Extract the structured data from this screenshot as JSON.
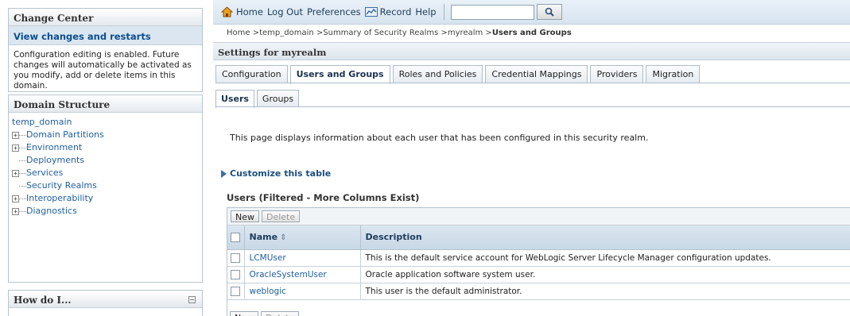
{
  "change_center": {
    "title": "Change Center",
    "link": "View changes and restarts",
    "message": "Configuration editing is enabled. Future changes will automatically be activated as you modify, add or delete items in this domain."
  },
  "domain_structure": {
    "title": "Domain Structure",
    "root": "temp_domain",
    "items": [
      {
        "label": "Domain Partitions",
        "expandable": true
      },
      {
        "label": "Environment",
        "expandable": true
      },
      {
        "label": "Deployments",
        "expandable": false
      },
      {
        "label": "Services",
        "expandable": true
      },
      {
        "label": "Security Realms",
        "expandable": false
      },
      {
        "label": "Interoperability",
        "expandable": true
      },
      {
        "label": "Diagnostics",
        "expandable": true
      }
    ]
  },
  "how_do_i": {
    "title": "How do I..."
  },
  "topbar": {
    "home": "Home",
    "logout": "Log Out",
    "preferences": "Preferences",
    "record": "Record",
    "help": "Help",
    "search_value": ""
  },
  "breadcrumb": {
    "path": "Home >temp_domain >Summary of Security Realms >myrealm >",
    "current": "Users and Groups"
  },
  "settings_title": "Settings for myrealm",
  "tabs": [
    "Configuration",
    "Users and Groups",
    "Roles and Policies",
    "Credential Mappings",
    "Providers",
    "Migration"
  ],
  "active_tab": "Users and Groups",
  "subtabs": [
    "Users",
    "Groups"
  ],
  "active_subtab": "Users",
  "intro_text": "This page displays information about each user that has been configured in this security realm.",
  "customize_label": "Customize this table",
  "table": {
    "title": "Users (Filtered - More Columns Exist)",
    "new_label": "New",
    "delete_label": "Delete",
    "columns": [
      "Name",
      "Description"
    ],
    "rows": [
      {
        "name": "LCMUser",
        "description": "This is the default service account for WebLogic Server Lifecycle Manager configuration updates."
      },
      {
        "name": "OracleSystemUser",
        "description": "Oracle application software system user."
      },
      {
        "name": "weblogic",
        "description": "This user is the default administrator."
      }
    ]
  },
  "colors": {
    "link": "#1f5f9f",
    "header_bg": "#dbe6f0",
    "panel_border": "#b8c4cf"
  }
}
